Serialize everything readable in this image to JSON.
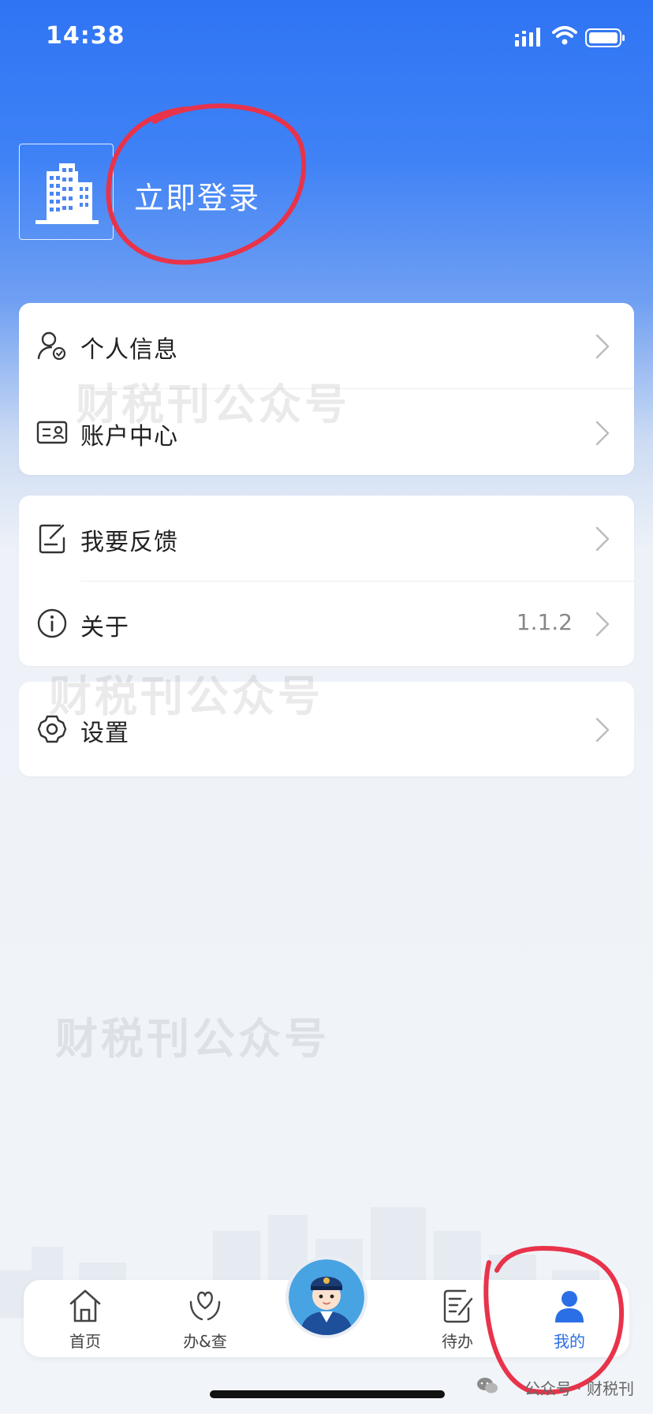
{
  "status_bar": {
    "time": "14:38"
  },
  "header": {
    "login_label": "立即登录"
  },
  "menu": {
    "group1": [
      {
        "label": "个人信息",
        "icon": "user-check-icon"
      },
      {
        "label": "账户中心",
        "icon": "id-card-icon"
      }
    ],
    "group2": [
      {
        "label": "我要反馈",
        "icon": "feedback-edit-icon"
      },
      {
        "label": "关于",
        "icon": "info-icon",
        "value": "1.1.2"
      }
    ],
    "group3": [
      {
        "label": "设置",
        "icon": "gear-icon"
      }
    ]
  },
  "watermark": "财税刊公众号",
  "tabbar": {
    "tabs": [
      {
        "label": "首页",
        "icon": "home-icon",
        "active": false
      },
      {
        "label": "办&查",
        "icon": "heart-hands-icon",
        "active": false
      },
      {
        "label": "",
        "icon": "assistant-avatar-icon",
        "active": false
      },
      {
        "label": "待办",
        "icon": "todo-note-icon",
        "active": false
      },
      {
        "label": "我的",
        "icon": "person-icon",
        "active": true
      }
    ]
  },
  "footer_mark": "公众号 · 财税刊",
  "colors": {
    "accent": "#2b6fe6",
    "annotation": "#e8334a"
  }
}
